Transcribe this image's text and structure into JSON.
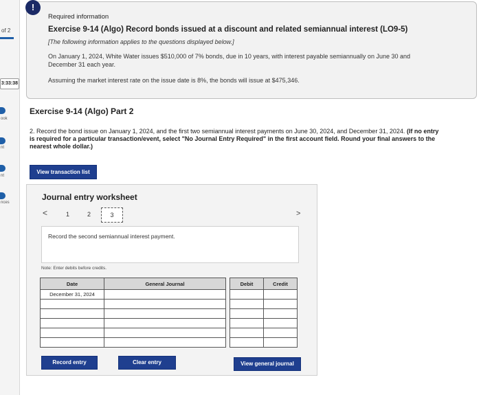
{
  "rail": {
    "page_indicator": "of 2",
    "timer": "3:33:38",
    "items": [
      "ook",
      "nt",
      "nt",
      "nces"
    ]
  },
  "info": {
    "alert_symbol": "!",
    "required": "Required information",
    "exercise_title": "Exercise 9-14 (Algo) Record bonds issued at a discount and related semiannual interest (LO9-5)",
    "note": "[The following information applies to the questions displayed below.]",
    "paragraph": "On January 1, 2024, White Water issues $510,000 of 7% bonds, due in 10 years, with interest payable semiannually on June 30 and December 31 each year.",
    "assumption": "Assuming the market interest rate on the issue date is 8%, the bonds will issue at $475,346."
  },
  "part": {
    "title": "Exercise 9-14 (Algo) Part 2",
    "instruction_plain": "2. Record the bond issue on January 1, 2024, and the first two semiannual interest payments on June 30, 2024, and December 31, 2024. ",
    "instruction_bold": "(If no entry is required for a particular transaction/event, select \"No Journal Entry Required\" in the first account field. Round your final answers to the nearest whole dollar.)"
  },
  "buttons": {
    "view_transaction_list": "View transaction list",
    "record_entry": "Record entry",
    "clear_entry": "Clear entry",
    "view_general_journal": "View general journal"
  },
  "worksheet": {
    "title": "Journal entry worksheet",
    "prev": "<",
    "next": ">",
    "pages": [
      "1",
      "2",
      "3"
    ],
    "current_page": "3",
    "prompt": "Record the second semiannual interest payment.",
    "note": "Note: Enter debits before credits.",
    "columns": [
      "Date",
      "General Journal",
      "Debit",
      "Credit"
    ],
    "rows": [
      {
        "date": "December 31, 2024",
        "account": "",
        "debit": "",
        "credit": ""
      },
      {
        "date": "",
        "account": "",
        "debit": "",
        "credit": ""
      },
      {
        "date": "",
        "account": "",
        "debit": "",
        "credit": ""
      },
      {
        "date": "",
        "account": "",
        "debit": "",
        "credit": ""
      },
      {
        "date": "",
        "account": "",
        "debit": "",
        "credit": ""
      },
      {
        "date": "",
        "account": "",
        "debit": "",
        "credit": ""
      }
    ]
  }
}
